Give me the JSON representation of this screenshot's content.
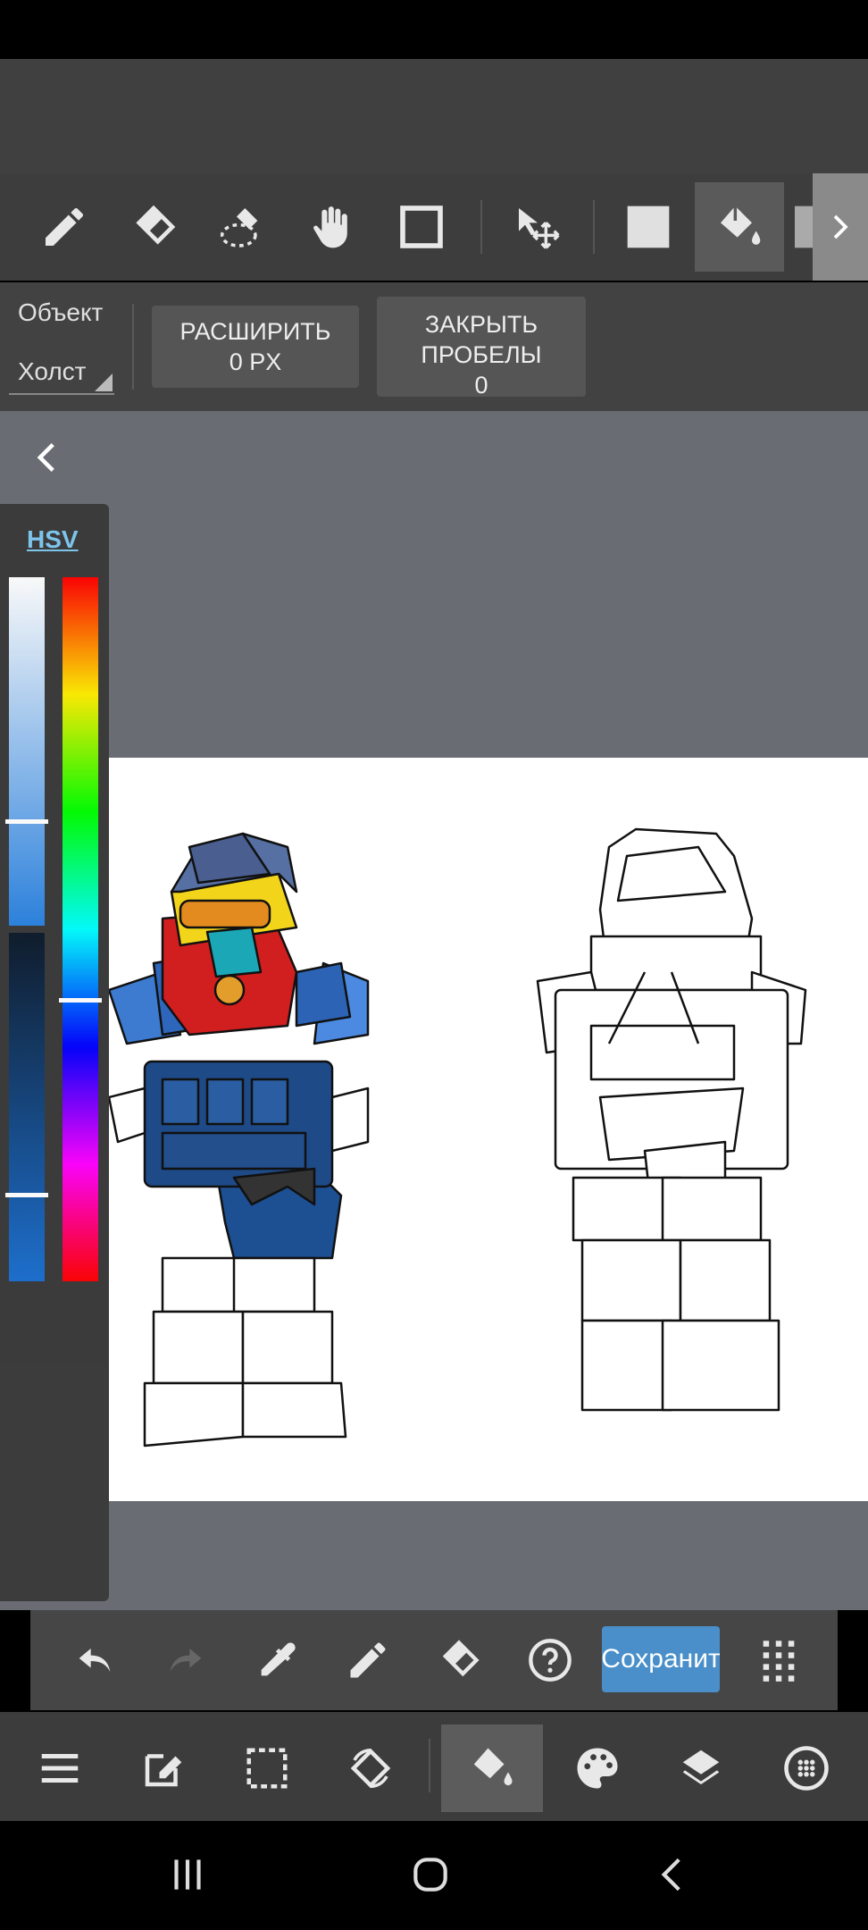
{
  "toolbar": {
    "tools": [
      "pen-tool",
      "eraser-tool",
      "lasso-eraser-tool",
      "hand-tool",
      "select-rect-tool",
      "move-tool",
      "fill-color-tool",
      "bucket-tool"
    ]
  },
  "options": {
    "object_label": "Объект",
    "canvas_label": "Холст",
    "expand_line1": "РАСШИРИТЬ",
    "expand_line2": "0 PX",
    "close_line1": "ЗАКРЫТЬ",
    "close_line2": "ПРОБЕЛЫ",
    "close_line3": "0"
  },
  "color_panel": {
    "mode_label": "HSV",
    "brightness_level": 0.75,
    "saturation_level": 0.7,
    "hue_level": 0.6
  },
  "bottom_tools": {
    "save_label": "Сохранит"
  },
  "colors": {
    "accent": "#4a8fc9",
    "panel_bg": "#3a3a3a",
    "workspace_bg": "#696c72"
  }
}
